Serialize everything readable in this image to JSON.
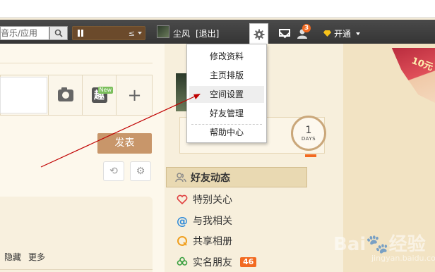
{
  "navbar": {
    "search_placeholder": "音乐/应用",
    "username": "尘风",
    "logout_label": "[退出]",
    "message_count": "3",
    "vip_label": "开通"
  },
  "dropdown": {
    "items": [
      {
        "label": "修改资料"
      },
      {
        "label": "主页排版"
      },
      {
        "label": "空间设置"
      },
      {
        "label": "好友管理"
      },
      {
        "label": "帮助中心"
      }
    ],
    "active_index": 2
  },
  "composer": {
    "new_tag": "New",
    "qu_label": "趣",
    "publish_label": "发表"
  },
  "feed_actions": [
    "隐藏",
    "更多"
  ],
  "days_card": {
    "number": "1",
    "label": "DAYS"
  },
  "sidebar": {
    "header": "好友动态",
    "items": [
      {
        "label": "特别关心"
      },
      {
        "label": "与我相关"
      },
      {
        "label": "共享相册"
      },
      {
        "label": "实名朋友",
        "badge": "46"
      }
    ]
  },
  "banner_text": "10元",
  "watermark": {
    "main": "Bai🐾经验",
    "sub": "jingyan.baidu.com"
  },
  "colors": {
    "accent_orange": "#f26a21",
    "publish_brown": "#c8966a",
    "annotation_red": "#c00000"
  }
}
